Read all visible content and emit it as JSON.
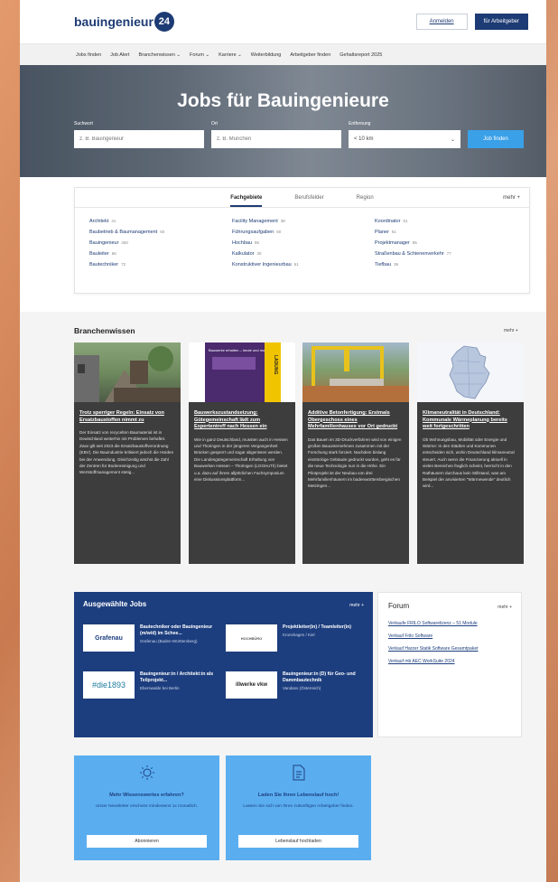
{
  "header": {
    "logo_text": "bauingenieur",
    "logo_badge": "24",
    "login_label": "Anmelden",
    "employer_label": "für Arbeitgeber"
  },
  "nav": [
    "Jobs finden",
    "Job Alert",
    "Branchenwissen ⌄",
    "Forum ⌄",
    "Karriere ⌄",
    "Weiterbildung",
    "Arbeitgeber finden",
    "Gehaltsreport 2025"
  ],
  "hero": {
    "title": "Jobs für Bauingenieure",
    "search_label": "Suchwort",
    "search_placeholder": "z. B. Bauingenieur",
    "location_label": "Ort",
    "location_placeholder": "z. B. München",
    "distance_label": "Entfernung",
    "distance_value": "< 10 km",
    "find_label": "Job finden"
  },
  "categories": {
    "tabs": [
      "Fachgebiete",
      "Berufsfelder",
      "Region"
    ],
    "more": "mehr +",
    "items": [
      {
        "name": "Architekt",
        "count": "41"
      },
      {
        "name": "Facility Management",
        "count": "38"
      },
      {
        "name": "Koordinator",
        "count": "61"
      },
      {
        "name": "Baubetrieb & Baumanagement",
        "count": "60"
      },
      {
        "name": "Führungsaufgaben",
        "count": "60"
      },
      {
        "name": "Planer",
        "count": "61"
      },
      {
        "name": "Bauingenieur",
        "count": "250"
      },
      {
        "name": "Hochbau",
        "count": "85"
      },
      {
        "name": "Projektmanager",
        "count": "85"
      },
      {
        "name": "Bauleiter",
        "count": "66"
      },
      {
        "name": "Kalkulator",
        "count": "30"
      },
      {
        "name": "Straßenbau & Schienenverkehr",
        "count": "77"
      },
      {
        "name": "Bautechniker",
        "count": "72"
      },
      {
        "name": "Konstruktiver Ingenieurbau",
        "count": "61"
      },
      {
        "name": "Tiefbau",
        "count": "36"
      }
    ]
  },
  "branchenwissen": {
    "title": "Branchenwissen",
    "more": "mehr +",
    "articles": [
      {
        "title": "Trotz sperriger Regeln: Einsatz von Ersatzbaustoffen nimmt zu",
        "text": "Der Einsatz von recycelten Baumaterial ist in Deutschland weiterhin mit Problemen behaftet. Zwar gilt seit 2023 die Ersatzbaustoffverordnung (EBV). Die Bauindustrie kritisiert jedoch die Hürden bei der Anwendung. Gleichzeitig wächst die Zahl der Zentren für Bodenreinigung und Wertstoffmanagement stetig..."
      },
      {
        "title": "Bauwerkszustandsetzung: Gütegemeinschaft lädt zum Expertentreff nach Hessen ein",
        "text": "Wie in ganz Deutschland, mussten auch in Hessen und Thüringen in der jüngeren Vergangenheit Brücken gesperrt und sogar abgerissen werden. Die Landesgütegemeinschaft Erhaltung von Bauwerken Hessen – Thüringen (LGGHuTh) bietet u.a. dazu auf ihrem alljährlichen Fachsymposium eine Diskussionsplattform..."
      },
      {
        "title": "Additive Betonfertigung: Erstmals Obergeschoss eines Mehrfamilienhauses vor Ort gedruckt",
        "text": "Das Bauen im 3D-Druckverfahren wird von einigen großen Bauunternehmen zusammen mit der Forschung stark forciert. Nachdem bislang einstöckige Gebäude gedruckt wurden, geht es für die neue Technologie nun in die Höhe. Ein Pilotprojekt ist der Neubau von drei Mehrfamilienhäusern im badenwürttembergischen Metzingen..."
      },
      {
        "title": "Klimaneutralität in Deutschland: Kommunale Wärmeplanung bereits weit fortgeschritten",
        "text": "Ob Wohnungsbau, Mobilität oder Energie und Wärme: In den Städten und Kommunen entscheiden sich, wohin Deutschland klimaneutral steuert. Auch wenn die Finanzierung aktuell in vielen Bereichen fraglich scheint, herrscht in den Rathäusern durchaus kein Stillstand, was am Beispiel der anvisierten \"Wärmewende\" deutlich wird..."
      }
    ],
    "poster_text": "Bauwerke erhalten – heute und morgen",
    "poster_side": "LADUNG"
  },
  "jobs": {
    "title": "Ausgewählte Jobs",
    "more": "mehr +",
    "items": [
      {
        "logo": "Grafenau",
        "title": "Bautechniker oder Bauingenieur (m/w/d) im Schee...",
        "place": "Grafenau (Baden-Württemberg)"
      },
      {
        "logo": "HOCHBÜRO",
        "title": "Projektleiter(in) / Teamleiter(in)",
        "place": "Kronshagen / Kiel"
      },
      {
        "logo": "#die1893",
        "title": "Bauingenieur:in / Architekt:in als Teilprojekt...",
        "place": "Eberswalde bei Berlin"
      },
      {
        "logo": "illwerke vkw",
        "title": "Bauingenieur:in (D) für Geo- und Dammbautechnik",
        "place": "Vandans (Österreich)"
      }
    ]
  },
  "forum": {
    "title": "Forum",
    "more": "mehr +",
    "items": [
      "Verkaufe FRILO Softwarelizenz – 51 Module",
      "Verkauf Frilo Software",
      "Verkauf Harzer Statik Software Gesamtpaket",
      "Verkauf mb AEC WorkSuite 2024"
    ]
  },
  "cta": [
    {
      "icon": "lightbulb-icon",
      "title": "Mehr Wissenswertes erfahren?",
      "text": "Unser Newsletter erscheint mindestens 1x monatlich.",
      "button": "Abonnieren"
    },
    {
      "icon": "document-icon",
      "title": "Laden Sie Ihren Lebenslauf hoch!",
      "text": "Lassen Sie sich von Ihren zukünftigen Arbeitgeber finden.",
      "button": "Lebenslauf hochladen"
    }
  ]
}
